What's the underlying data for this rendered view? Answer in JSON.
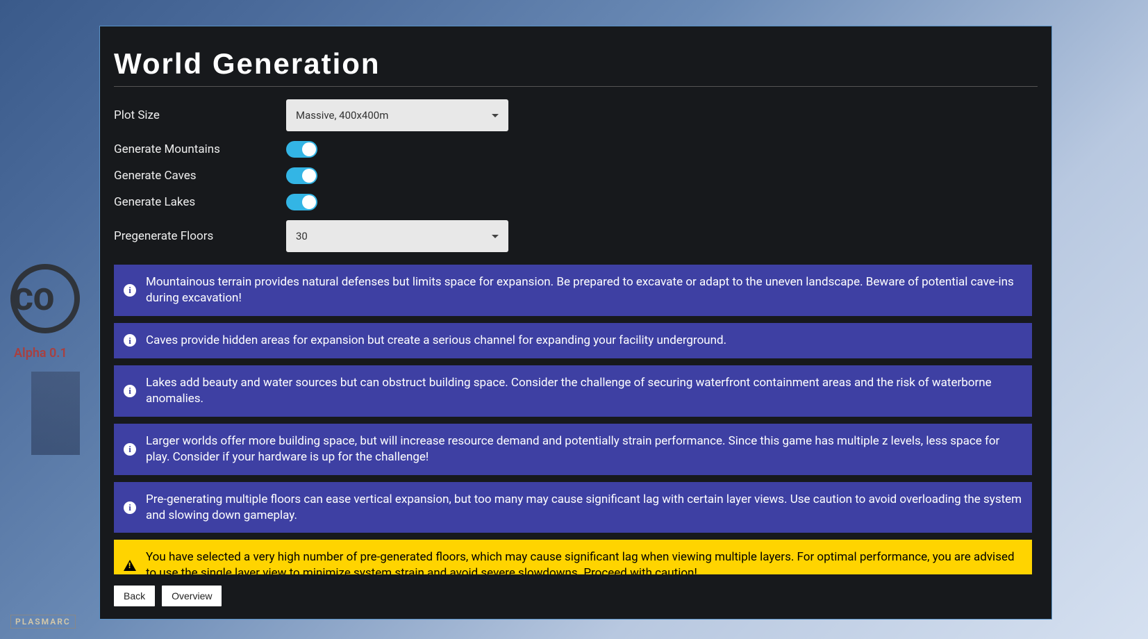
{
  "background": {
    "alpha_label": "Alpha 0.1",
    "badge": "PLASMARC"
  },
  "panel": {
    "title": "World Generation",
    "fields": {
      "plot_size": {
        "label": "Plot Size",
        "value": "Massive, 400x400m"
      },
      "generate_mountains": {
        "label": "Generate Mountains",
        "value": true
      },
      "generate_caves": {
        "label": "Generate Caves",
        "value": true
      },
      "generate_lakes": {
        "label": "Generate Lakes",
        "value": true
      },
      "pregenerate_floors": {
        "label": "Pregenerate Floors",
        "value": "30"
      }
    },
    "messages": [
      {
        "type": "info",
        "text": "Mountainous terrain provides natural defenses but limits space for expansion. Be prepared to excavate or adapt to the uneven landscape. Beware of potential cave-ins during excavation!"
      },
      {
        "type": "info",
        "text": "Caves provide hidden areas for expansion but create a serious channel for expanding your facility underground."
      },
      {
        "type": "info",
        "text": "Lakes add beauty and water sources but can obstruct building space. Consider the challenge of securing waterfront containment areas and the risk of waterborne anomalies."
      },
      {
        "type": "info",
        "text": "Larger worlds offer more building space, but will increase resource demand and potentially strain performance. Since this game has multiple z levels, less space for play. Consider if your hardware is up for the challenge!"
      },
      {
        "type": "info",
        "text": "Pre-generating multiple floors can ease vertical expansion, but too many may cause significant lag with certain layer views. Use caution to avoid overloading the system and slowing down gameplay."
      },
      {
        "type": "warn",
        "text": "You have selected a very high number of pre-generated floors, which may cause significant lag when viewing multiple layers. For optimal performance, you are advised to use the single layer view to minimize system strain and avoid severe slowdowns. Proceed with caution!"
      }
    ],
    "footer": {
      "back": "Back",
      "overview": "Overview"
    }
  }
}
